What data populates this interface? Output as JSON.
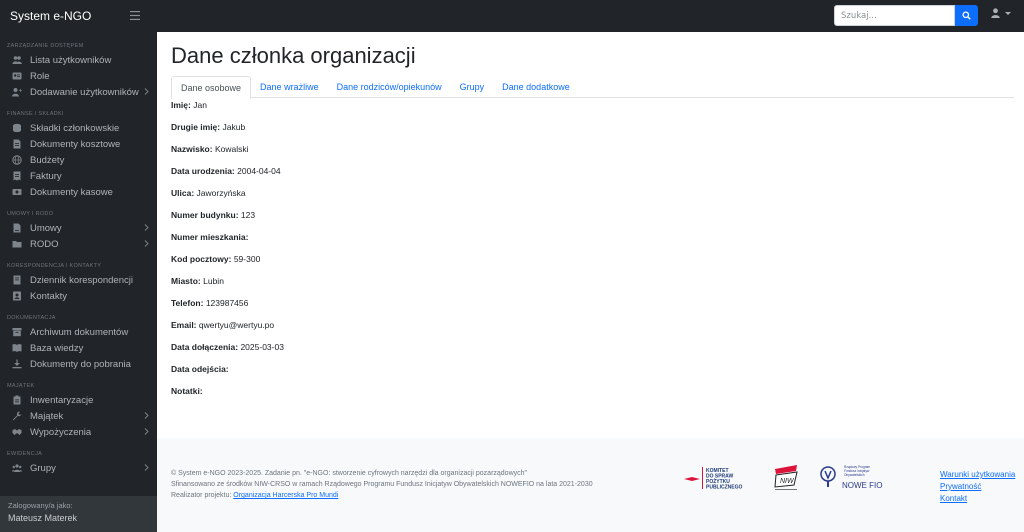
{
  "app": {
    "brand": "System e-NGO"
  },
  "search": {
    "placeholder": "Szukaj..."
  },
  "sidebar": {
    "sections": [
      {
        "heading": "ZARZĄDZANIE DOSTĘPEM",
        "items": [
          {
            "label": "Lista użytkowników",
            "icon": "users-icon",
            "chevron": false
          },
          {
            "label": "Role",
            "icon": "id-card-icon",
            "chevron": false
          },
          {
            "label": "Dodawanie użytkowników",
            "icon": "user-plus-icon",
            "chevron": true
          }
        ]
      },
      {
        "heading": "FINANSE I SKŁADKI",
        "items": [
          {
            "label": "Składki członkowskie",
            "icon": "coins-icon",
            "chevron": false
          },
          {
            "label": "Dokumenty kosztowe",
            "icon": "document-icon",
            "chevron": false
          },
          {
            "label": "Budżety",
            "icon": "globe-icon",
            "chevron": false
          },
          {
            "label": "Faktury",
            "icon": "invoice-icon",
            "chevron": false
          },
          {
            "label": "Dokumenty kasowe",
            "icon": "cash-icon",
            "chevron": false
          }
        ]
      },
      {
        "heading": "UMOWY I RODO",
        "items": [
          {
            "label": "Umowy",
            "icon": "contract-icon",
            "chevron": true
          },
          {
            "label": "RODO",
            "icon": "folder-icon",
            "chevron": true
          }
        ]
      },
      {
        "heading": "KORESPONDENCJA I KONTAKTY",
        "items": [
          {
            "label": "Dziennik korespondencji",
            "icon": "journal-icon",
            "chevron": false
          },
          {
            "label": "Kontakty",
            "icon": "contacts-icon",
            "chevron": false
          }
        ]
      },
      {
        "heading": "DOKUMENTACJA",
        "items": [
          {
            "label": "Archiwum dokumentów",
            "icon": "archive-icon",
            "chevron": false
          },
          {
            "label": "Baza wiedzy",
            "icon": "book-icon",
            "chevron": false
          },
          {
            "label": "Dokumenty do pobrania",
            "icon": "download-icon",
            "chevron": false
          }
        ]
      },
      {
        "heading": "MAJĄTEK",
        "items": [
          {
            "label": "Inwentaryzacje",
            "icon": "clipboard-icon",
            "chevron": false
          },
          {
            "label": "Majątek",
            "icon": "wrench-icon",
            "chevron": true
          },
          {
            "label": "Wypożyczenia",
            "icon": "handshake-icon",
            "chevron": true
          }
        ]
      },
      {
        "heading": "EWIDENCJA",
        "items": [
          {
            "label": "Grupy",
            "icon": "group-icon",
            "chevron": true
          }
        ]
      }
    ],
    "footer": {
      "logged_label": "Zalogowany/a jako:",
      "user_name": "Mateusz Materek"
    }
  },
  "main": {
    "title": "Dane członka organizacji",
    "tabs": [
      {
        "label": "Dane osobowe",
        "active": true
      },
      {
        "label": "Dane wrażliwe",
        "active": false
      },
      {
        "label": "Dane rodziców/opiekunów",
        "active": false
      },
      {
        "label": "Grupy",
        "active": false
      },
      {
        "label": "Dane dodatkowe",
        "active": false
      }
    ],
    "fields": [
      {
        "label": "Imię:",
        "value": "Jan"
      },
      {
        "label": "Drugie imię:",
        "value": "Jakub"
      },
      {
        "label": "Nazwisko:",
        "value": "Kowalski"
      },
      {
        "label": "Data urodzenia:",
        "value": "2004-04-04"
      },
      {
        "label": "Ulica:",
        "value": "Jaworzyńska"
      },
      {
        "label": "Numer budynku:",
        "value": "123"
      },
      {
        "label": "Numer mieszkania:",
        "value": ""
      },
      {
        "label": "Kod pocztowy:",
        "value": "59-300"
      },
      {
        "label": "Miasto:",
        "value": "Lubin"
      },
      {
        "label": "Telefon:",
        "value": "123987456"
      },
      {
        "label": "Email:",
        "value": "qwertyu@wertyu.po"
      },
      {
        "label": "Data dołączenia:",
        "value": "2025-03-03"
      },
      {
        "label": "Data odejścia:",
        "value": ""
      },
      {
        "label": "Notatki:",
        "value": ""
      }
    ]
  },
  "footer": {
    "line1": "© System e-NGO 2023-2025. Zadanie pn. \"e-NGO: stworzenie cyfrowych narzędzi dla organizacji pozarządowych\"",
    "line2": "Sfinansowano ze środków NIW-CRSO w ramach Rządowego Programu Fundusz Inicjatyw Obywatelskich NOWEFIO na lata 2021-2030",
    "line3_prefix": "Realizator projektu:",
    "line3_link": "Organizacja Harcerska Pro Mundi",
    "logos": {
      "kppp": {
        "line1": "KOMITET",
        "line2": "DO SPRAW",
        "line3": "POŻYTKU",
        "line4": "PUBLICZNEGO"
      },
      "niw": {
        "text": "NIW"
      },
      "fio": {
        "small1": "Rządowy Program",
        "small2": "Fundusz Inicjatyw",
        "small3": "Obywatelskich",
        "big": "NOWE FIO"
      }
    },
    "links": [
      "Warunki użytkowania",
      "Prywatność",
      "Kontakt"
    ]
  },
  "colors": {
    "accent": "#0d6efd",
    "sidebar_bg": "#212529",
    "footer_bg": "#f8f9fa"
  }
}
